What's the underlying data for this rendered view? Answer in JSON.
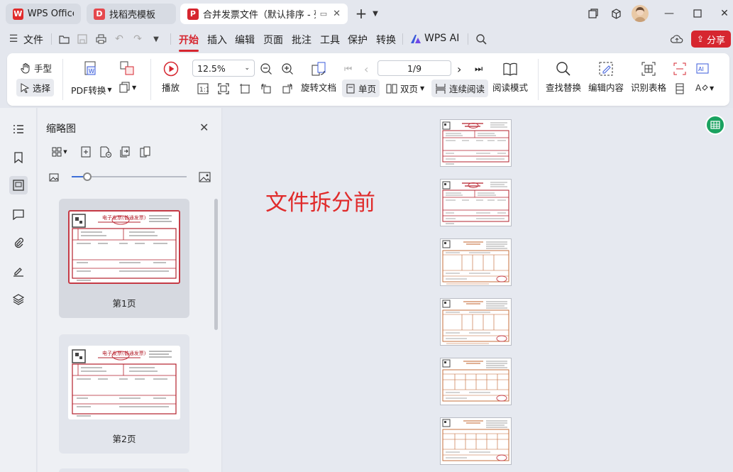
{
  "tabs": [
    {
      "label": "WPS Office",
      "icon": "wps-logo-icon",
      "state": "inactive"
    },
    {
      "label": "找稻壳模板",
      "icon": "docer-logo-icon",
      "state": "inactive"
    },
    {
      "label": "合并发票文件（默认排序 - 列",
      "icon": "pdf-logo-icon",
      "state": "active"
    }
  ],
  "menu": {
    "file": "文件",
    "items": [
      "开始",
      "插入",
      "编辑",
      "页面",
      "批注",
      "工具",
      "保护",
      "转换"
    ],
    "active": "开始",
    "wps_ai": "WPS AI",
    "share": "分享"
  },
  "ribbon": {
    "hand": "手型",
    "select": "选择",
    "pdf_convert": "PDF转换",
    "play": "播放",
    "zoom": "12.5%",
    "rotate": "旋转文档",
    "page_indicator": "1/9",
    "single_page": "单页",
    "double_page": "双页",
    "continuous": "连续阅读",
    "reading_mode": "阅读模式",
    "find_replace": "查找替换",
    "edit_content": "编辑内容",
    "recognize_table": "识别表格"
  },
  "thumbnail_panel": {
    "title": "缩略图",
    "pages": [
      {
        "label": "第1页",
        "selected": true
      },
      {
        "label": "第2页",
        "selected": false
      }
    ]
  },
  "main": {
    "annotation": "文件拆分前",
    "page_count_shown": 6
  },
  "colors": {
    "accent": "#d6262f",
    "annotation": "#e02b2b",
    "invoice_red": "#b3202c",
    "invoice_orange": "#c0602a"
  }
}
